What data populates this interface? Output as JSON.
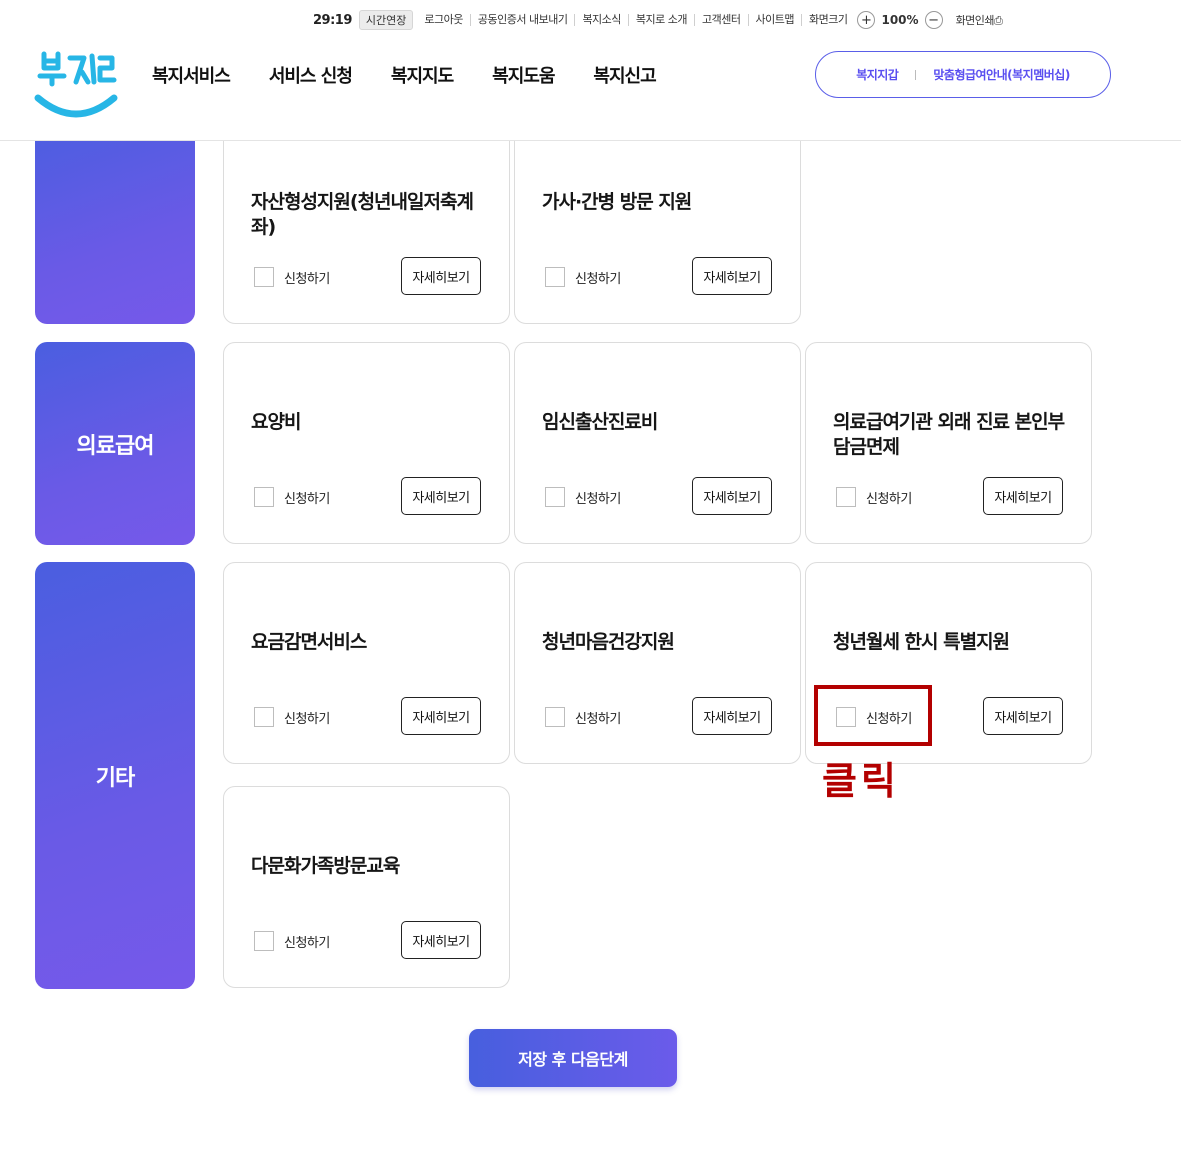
{
  "utility": {
    "timer": "29:19",
    "extend_label": "시간연장",
    "links": [
      "로그아웃",
      "공동인증서 내보내기",
      "복지소식",
      "복지로 소개",
      "고객센터",
      "사이트맵",
      "화면크기"
    ],
    "zoom_in": "+",
    "zoom_value": "100%",
    "zoom_out": "−",
    "print_label": "화면인쇄"
  },
  "header": {
    "logo_text": "복지로",
    "nav": [
      "복지서비스",
      "서비스 신청",
      "복지지도",
      "복지도움",
      "복지신고"
    ],
    "pill_left": "복지지갑",
    "pill_right": "맞춤형급여안내(복지멤버십)"
  },
  "categories": [
    {
      "name": ""
    },
    {
      "name": "의료급여"
    },
    {
      "name": "기타"
    }
  ],
  "cards": [
    {
      "title": "자산형성지원(청년내일저축계좌)",
      "apply": "신청하기",
      "detail": "자세히보기"
    },
    {
      "title": "가사·간병 방문 지원",
      "apply": "신청하기",
      "detail": "자세히보기"
    },
    {
      "title": "요양비",
      "apply": "신청하기",
      "detail": "자세히보기"
    },
    {
      "title": "임신출산진료비",
      "apply": "신청하기",
      "detail": "자세히보기"
    },
    {
      "title": "의료급여기관 외래 진료 본인부담금면제",
      "apply": "신청하기",
      "detail": "자세히보기"
    },
    {
      "title": "요금감면서비스",
      "apply": "신청하기",
      "detail": "자세히보기"
    },
    {
      "title": "청년마음건강지원",
      "apply": "신청하기",
      "detail": "자세히보기"
    },
    {
      "title": "청년월세 한시 특별지원",
      "apply": "신청하기",
      "detail": "자세히보기"
    },
    {
      "title": "다문화가족방문교육",
      "apply": "신청하기",
      "detail": "자세히보기"
    }
  ],
  "annotation": {
    "text": "클릭",
    "color": "#b30000"
  },
  "save_button": "저장 후 다음단계",
  "colors": {
    "accent": "#5a4ff0",
    "category_gradient_start": "#4a5ee0",
    "category_gradient_end": "#7659ea"
  }
}
